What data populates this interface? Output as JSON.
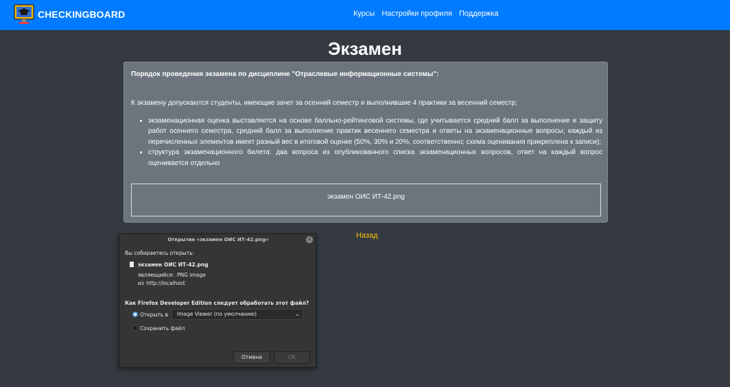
{
  "navbar": {
    "brand": "CHECKINGBOARD",
    "links": [
      "Курсы",
      "Настройки профиля",
      "Поддержка"
    ]
  },
  "page": {
    "title": "Экзамен",
    "heading": "Порядок проведения экзамена по дисциплине \"Отраслевые информационные системы\":",
    "intro": "К экзамену допускаются студенты, имеющие зачет за осенний семестр и выполнившие 4 практики за весенний семестр;",
    "items": [
      "экзаменационная оценка выставляется на основе балльно-рейтинговой системы, где учитывается средний балл за выполнение и защиту работ осеннего семестра, средний балл за выполнение практик весеннего семестра и ответы на экзаменационные вопросы; каждый из перечисленных элементов имеет разный вес в итоговой оценке (50%, 30% и 20%, соответственно; схема оценивания прикреплена к записи);",
      "структура экзаменационного билета: два вопроса из опубликованного списка экзаменационных вопросов, ответ на каждый вопрос оценивается отдельно"
    ],
    "attachment": "экзамен ОИС ИТ-42.png",
    "back_link": "Назад"
  },
  "dialog": {
    "title": "Открытие «экзамен ОИС ИТ-42.png»",
    "about_to_open": "Вы собираетесь открыть:",
    "filename": "экзамен ОИС ИТ-42.png",
    "type_label": "являющийся:",
    "type_value": "PNG image",
    "from_label": "из",
    "from_value": "http://localhost",
    "question": "Как Firefox Developer Edition следует обработать этот файл?",
    "open_with_label": "Открыть в",
    "open_with_value": "Image Viewer (по умолчанию)",
    "save_label": "Сохранить файл",
    "cancel": "Отмена",
    "ok": "OK"
  },
  "colors": {
    "navbar": "#007bff",
    "background": "#343a40",
    "panel": "#6c757d",
    "link_accent": "#ffc107",
    "radio_selected": "#5294e2"
  },
  "icons": {
    "brand": "monitor-graduation-cap-icon",
    "close": "close-icon",
    "file": "file-icon",
    "dropdown": "chevron-down-icon"
  }
}
